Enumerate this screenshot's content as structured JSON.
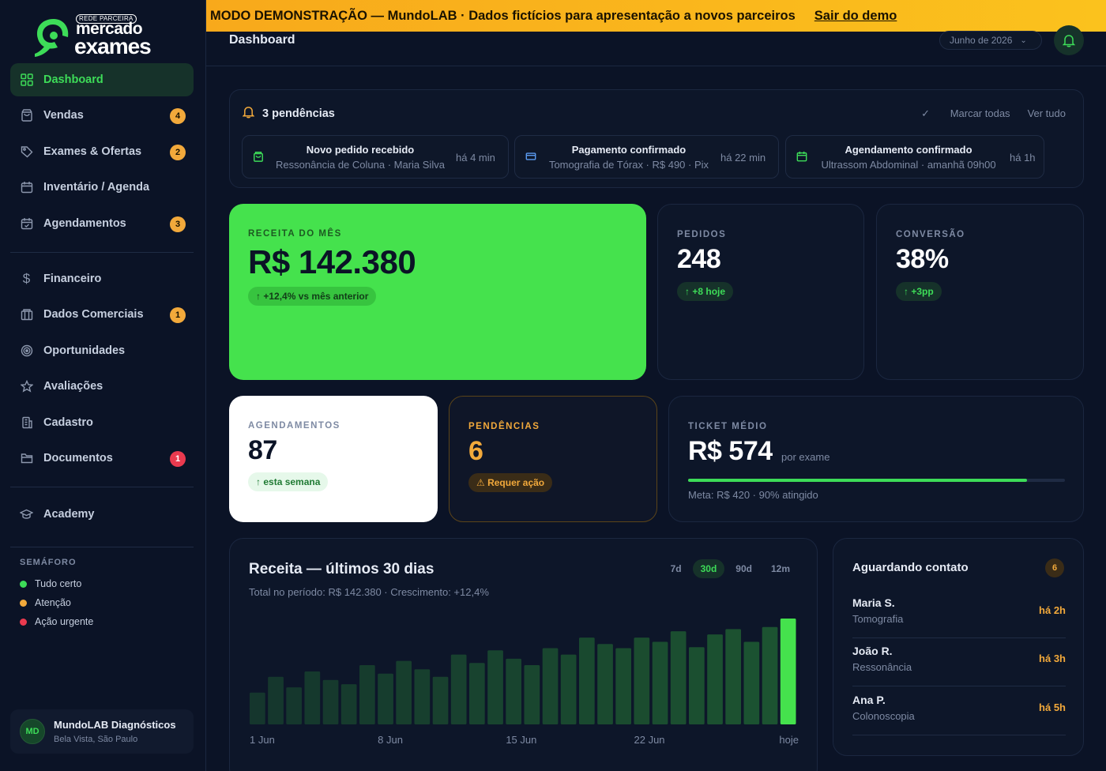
{
  "logo": {
    "tag": "REDE PARCEIRA",
    "word1": "mercado",
    "word2": "exames"
  },
  "banner": {
    "text": "MODO DEMONSTRAÇÃO — MundoLAB · Dados fictícios para apresentação a novos parceiros",
    "exit_label": "Sair do demo"
  },
  "header": {
    "title": "Dashboard",
    "period": "Junho de 2026"
  },
  "sidebar": {
    "items": [
      {
        "label": "Dashboard",
        "icon": "grid-icon",
        "active": true
      },
      {
        "label": "Vendas",
        "icon": "bag-icon",
        "count": "4"
      },
      {
        "label": "Exames & Ofertas",
        "icon": "tag-icon",
        "count": "2"
      },
      {
        "label": "Inventário / Agenda",
        "icon": "calendar-icon"
      },
      {
        "label": "Agendamentos",
        "icon": "calendar-check-icon",
        "count": "3"
      },
      {
        "label": "Financeiro",
        "icon": "dollar-icon"
      },
      {
        "label": "Dados Comerciais",
        "icon": "building-icon",
        "count": "1"
      },
      {
        "label": "Oportunidades",
        "icon": "target-icon"
      },
      {
        "label": "Avaliações",
        "icon": "star-icon"
      },
      {
        "label": "Cadastro",
        "icon": "office-icon"
      },
      {
        "label": "Documentos",
        "icon": "folder-icon",
        "count": "1"
      },
      {
        "label": "Academy",
        "icon": "graduation-cap-icon"
      }
    ],
    "semaforo": {
      "title": "SEMÁFORO",
      "items": [
        {
          "label": "Tudo certo",
          "color": "#3ddc58"
        },
        {
          "label": "Atenção",
          "color": "#f2a93b"
        },
        {
          "label": "Ação urgente",
          "color": "#ea3a4f"
        }
      ]
    },
    "company": {
      "initials": "MD",
      "name": "MundoLAB Diagnósticos",
      "location": "Bela Vista, São Paulo"
    }
  },
  "pendings": {
    "title": "3 pendências",
    "mark_all": "Marcar todas",
    "see_all": "Ver tudo",
    "items": [
      {
        "title": "Novo pedido recebido",
        "sub": "Ressonância de Coluna · Maria Silva",
        "time": "há 4 min",
        "icon": "bag-icon"
      },
      {
        "title": "Pagamento confirmado",
        "sub": "Tomografia de Tórax · R$ 490 · Pix",
        "time": "há 22 min",
        "icon": "card-icon"
      },
      {
        "title": "Agendamento confirmado",
        "sub": "Ultrassom Abdominal · amanhã 09h00",
        "time": "há 1h",
        "icon": "calendar-icon"
      }
    ]
  },
  "kpis": {
    "receita": {
      "label": "RECEITA DO MÊS",
      "value": "R$ 142.380",
      "delta": "+12,4% vs mês anterior"
    },
    "pedidos": {
      "label": "PEDIDOS",
      "value": "248",
      "delta": "+8 hoje"
    },
    "conversao": {
      "label": "CONVERSÃO",
      "value": "38%",
      "delta": "+3pp"
    },
    "agendamentos": {
      "label": "AGENDAMENTOS",
      "value": "87",
      "delta": "esta semana"
    },
    "pendencias": {
      "label": "PENDÊNCIAS",
      "value": "6",
      "delta": "Requer ação"
    },
    "ticket": {
      "label": "TICKET MÉDIO",
      "value": "R$ 574",
      "unit": "por exame",
      "progress": 0.9,
      "meta": "Meta: R$ 420 · 90% atingido"
    }
  },
  "revenue": {
    "title": "Receita — últimos 30 dias",
    "subtitle": "Total no período: R$ 142.380 · Crescimento: +12,4%",
    "ranges": [
      "7d",
      "30d",
      "90d",
      "12m"
    ],
    "active_range": "30d"
  },
  "chart_data": {
    "type": "bar",
    "x_tick_labels": [
      "1 Jun",
      "8 Jun",
      "15 Jun",
      "22 Jun",
      "hoje"
    ],
    "values": [
      30,
      45,
      35,
      50,
      42,
      38,
      56,
      48,
      60,
      52,
      45,
      66,
      58,
      70,
      62,
      56,
      72,
      66,
      82,
      76,
      72,
      82,
      78,
      88,
      73,
      85,
      90,
      78,
      92,
      100
    ],
    "grid": false,
    "highlight_last": true
  },
  "contacts": {
    "title": "Aguardando contato",
    "count": "6",
    "items": [
      {
        "name": "Maria S.",
        "exam": "Tomografia",
        "time": "há 2h"
      },
      {
        "name": "João R.",
        "exam": "Ressonância",
        "time": "há 3h"
      },
      {
        "name": "Ana P.",
        "exam": "Colonoscopia",
        "time": "há 5h"
      }
    ]
  }
}
